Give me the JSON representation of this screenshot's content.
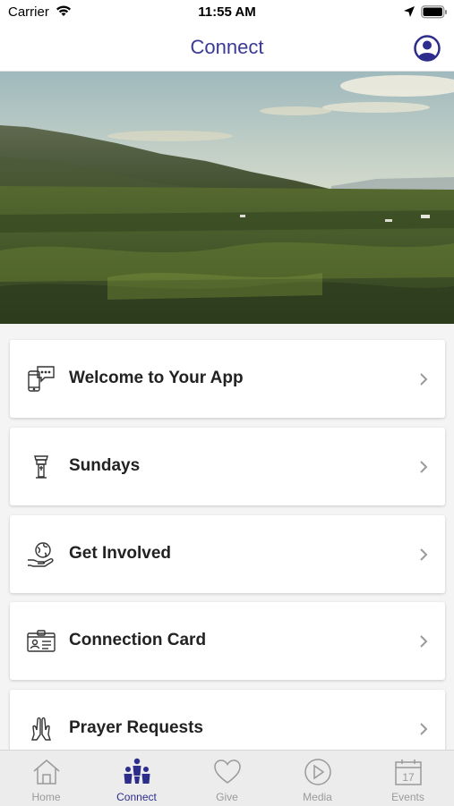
{
  "status_bar": {
    "carrier": "Carrier",
    "time": "11:55 AM"
  },
  "nav": {
    "title": "Connect",
    "profile_icon": "user-circle-icon"
  },
  "hero": {
    "description_icon": "landscape-photo"
  },
  "menu": [
    {
      "label": "Welcome to Your App",
      "icon": "phone-chat-icon"
    },
    {
      "label": "Sundays",
      "icon": "pulpit-icon"
    },
    {
      "label": "Get Involved",
      "icon": "globe-hand-icon"
    },
    {
      "label": "Connection Card",
      "icon": "id-card-icon"
    },
    {
      "label": "Prayer Requests",
      "icon": "praying-hands-icon"
    }
  ],
  "tabs": [
    {
      "label": "Home",
      "icon": "home-icon",
      "active": false
    },
    {
      "label": "Connect",
      "icon": "people-icon",
      "active": true
    },
    {
      "label": "Give",
      "icon": "heart-icon",
      "active": false
    },
    {
      "label": "Media",
      "icon": "play-icon",
      "active": false
    },
    {
      "label": "Events",
      "icon": "calendar-icon",
      "active": false,
      "calendar_day": "17"
    }
  ],
  "colors": {
    "accent": "#3a3a96",
    "tab_active": "#2d2d8c",
    "tab_inactive": "#9a9a9a",
    "background": "#f4f4f5"
  }
}
